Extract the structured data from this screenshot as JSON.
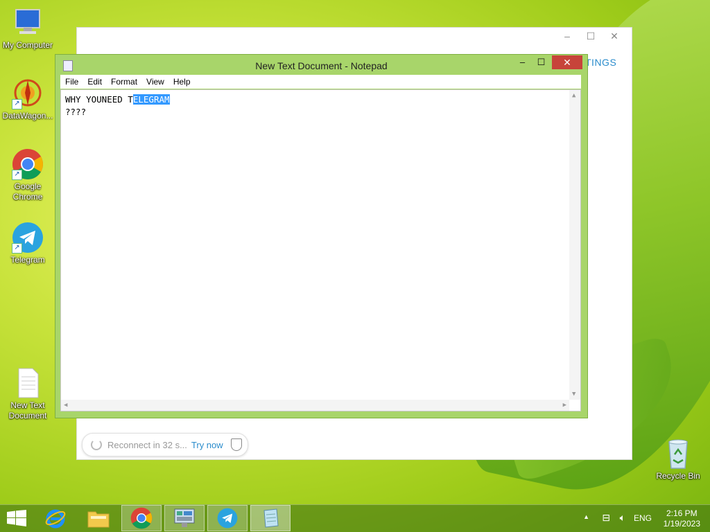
{
  "desktop": {
    "icons": [
      {
        "label": "My Computer"
      },
      {
        "label": "DataWagon..."
      },
      {
        "label_line1": "Google",
        "label_line2": "Chrome"
      },
      {
        "label": "Telegram"
      },
      {
        "label_line1": "New Text",
        "label_line2": "Document"
      }
    ],
    "recycle_bin": "Recycle Bin"
  },
  "telegram_window": {
    "settings_text": "TINGS",
    "reconnect_text": "Reconnect in 32 s...",
    "try_now": "Try now"
  },
  "notepad": {
    "title": "New Text Document - Notepad",
    "menu": [
      "File",
      "Edit",
      "Format",
      "View",
      "Help"
    ],
    "text_line1_unselected": "WHY YOUNEED T",
    "text_line1_selected": "ELEGRAM",
    "text_line2": "????"
  },
  "taskbar": {
    "language": "ENG",
    "time": "2:16 PM",
    "date": "1/19/2023"
  },
  "colors": {
    "notepad_frame": "#a8d56a",
    "close_button": "#c7443a",
    "selection": "#3399ff",
    "telegram_accent": "#2a8ccc"
  }
}
